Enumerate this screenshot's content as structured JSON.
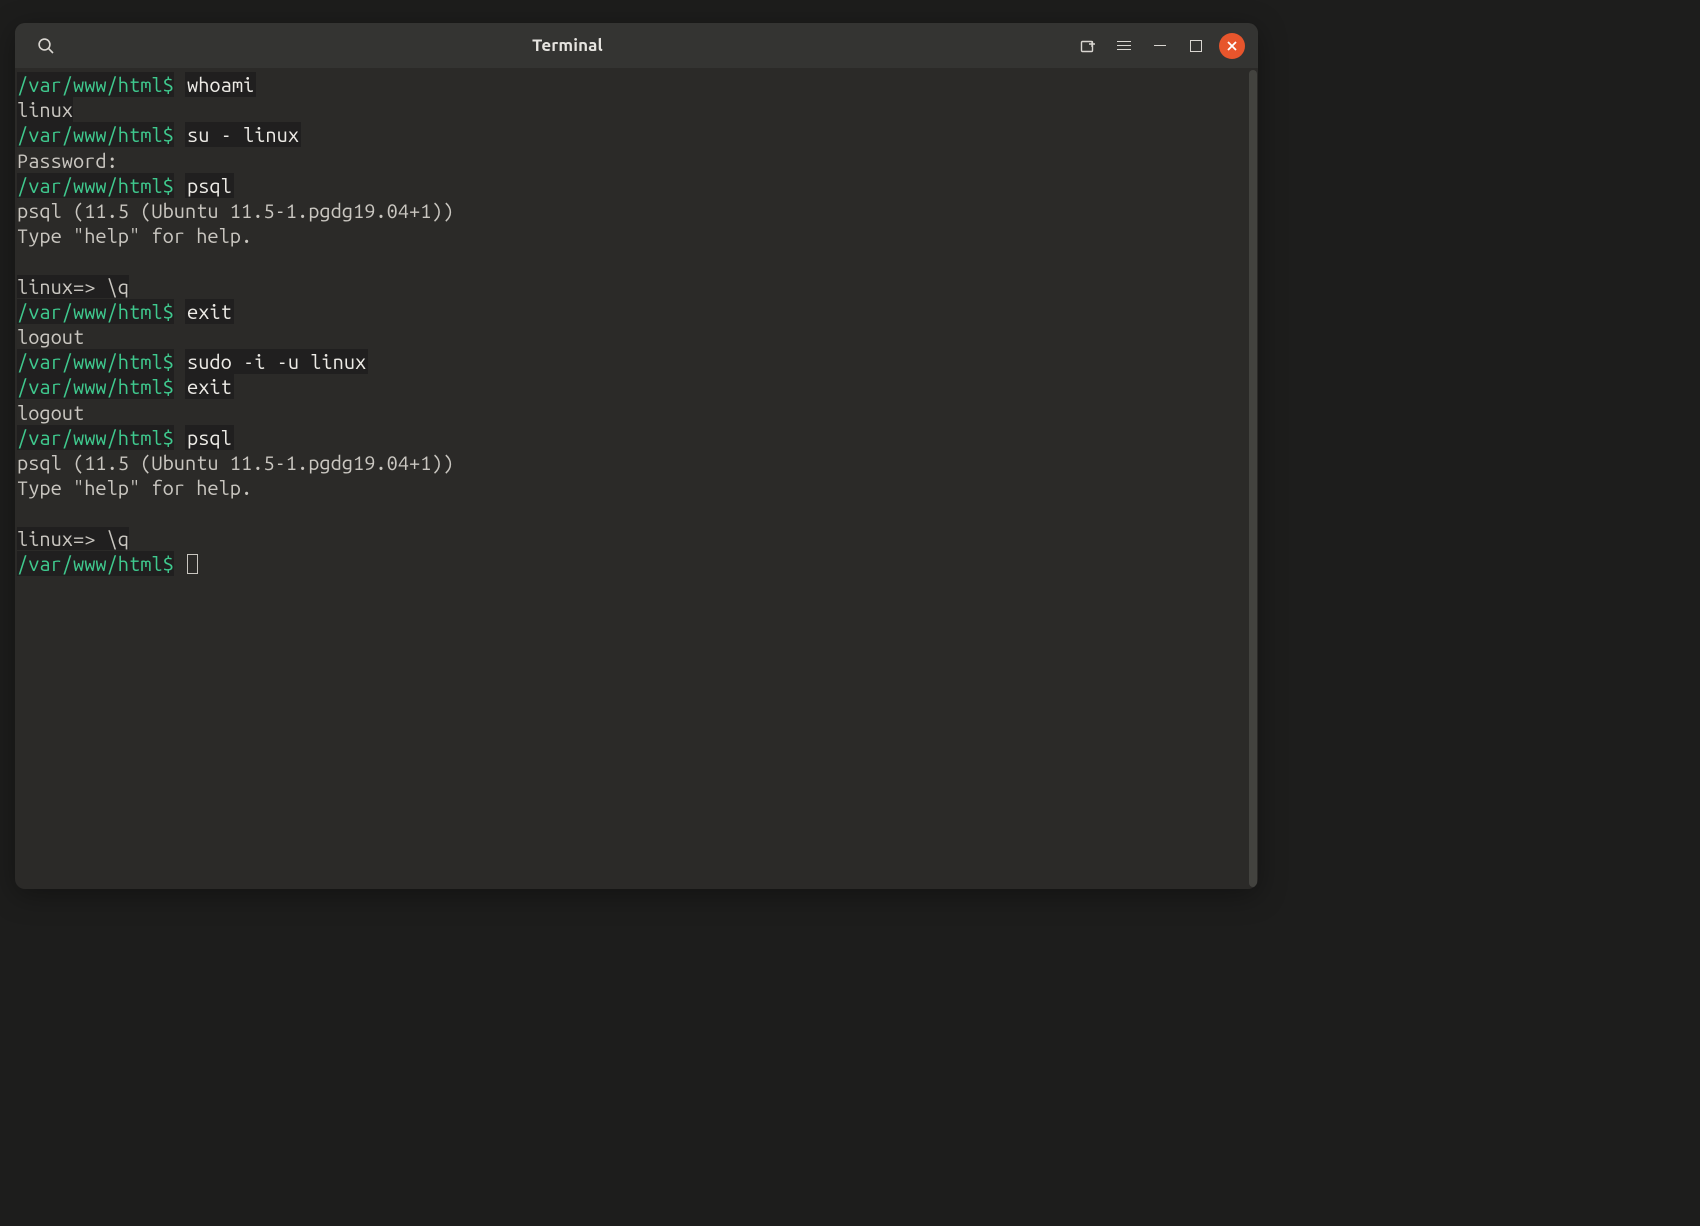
{
  "titlebar": {
    "title": "Terminal",
    "search_icon": "search",
    "newtab_icon": "new-tab",
    "menu_icon": "hamburger",
    "min_icon": "minimize",
    "max_icon": "maximize",
    "close_icon": "close"
  },
  "colors": {
    "prompt": "#3fc98e",
    "bg": "#2b2a28",
    "fg": "#c9c6c0",
    "close": "#e7552c"
  },
  "lines": [
    {
      "type": "prompt",
      "path": "/var/www/html",
      "sigil": "$",
      "cmd": "whoami"
    },
    {
      "type": "output",
      "text": "linux"
    },
    {
      "type": "prompt",
      "path": "/var/www/html",
      "sigil": "$",
      "cmd": "su - linux"
    },
    {
      "type": "plain",
      "text": "Password:"
    },
    {
      "type": "prompt",
      "path": "/var/www/html",
      "sigil": "$",
      "cmd": "psql"
    },
    {
      "type": "plain",
      "text": "psql (11.5 (Ubuntu 11.5-1.pgdg19.04+1))"
    },
    {
      "type": "plain",
      "text": "Type \"help\" for help."
    },
    {
      "type": "blank"
    },
    {
      "type": "psql",
      "prompt": "linux=>",
      "cmd": "\\q"
    },
    {
      "type": "prompt",
      "path": "/var/www/html",
      "sigil": "$",
      "cmd": "exit"
    },
    {
      "type": "plain",
      "text": "logout"
    },
    {
      "type": "prompt",
      "path": "/var/www/html",
      "sigil": "$",
      "cmd": "sudo -i -u linux"
    },
    {
      "type": "prompt",
      "path": "/var/www/html",
      "sigil": "$",
      "cmd": "exit"
    },
    {
      "type": "plain",
      "text": "logout"
    },
    {
      "type": "prompt",
      "path": "/var/www/html",
      "sigil": "$",
      "cmd": "psql"
    },
    {
      "type": "plain",
      "text": "psql (11.5 (Ubuntu 11.5-1.pgdg19.04+1))"
    },
    {
      "type": "plain",
      "text": "Type \"help\" for help."
    },
    {
      "type": "blank"
    },
    {
      "type": "psql",
      "prompt": "linux=>",
      "cmd": "\\q"
    },
    {
      "type": "prompt-cursor",
      "path": "/var/www/html",
      "sigil": "$"
    }
  ]
}
